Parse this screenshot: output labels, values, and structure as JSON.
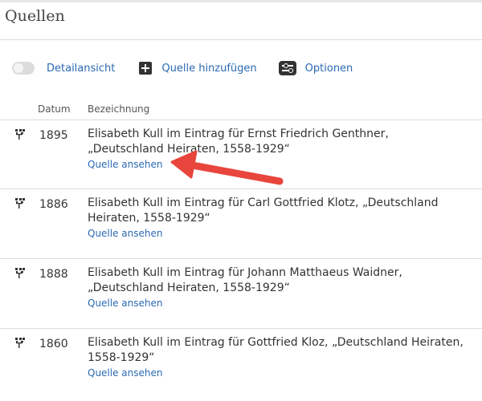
{
  "page": {
    "title": "Quellen"
  },
  "toolbar": {
    "detail_label": "Detailansicht",
    "add_label": "Quelle hinzufügen",
    "options_label": "Optionen"
  },
  "table": {
    "columns": [
      "Datum",
      "Bezeichnung"
    ],
    "rows": [
      {
        "date": "1895",
        "title": "Elisabeth Kull im Eintrag für Ernst Friedrich Genthner, „Deutschland Heiraten, 1558-1929“",
        "link": "Quelle ansehen"
      },
      {
        "date": "1886",
        "title": "Elisabeth Kull im Eintrag für Carl Gottfried Klotz, „Deutschland Heiraten, 1558-1929“",
        "link": "Quelle ansehen"
      },
      {
        "date": "1888",
        "title": "Elisabeth Kull im Eintrag für Johann Matthaeus Waidner, „Deutschland Heiraten, 1558-1929“",
        "link": "Quelle ansehen"
      },
      {
        "date": "1860",
        "title": "Elisabeth Kull im Eintrag für Gottfried Kloz, „Deutschland Heiraten, 1558-1929“",
        "link": "Quelle ansehen"
      }
    ]
  },
  "colors": {
    "link": "#2b6ab3",
    "annotation_arrow": "#e8453c"
  },
  "icons": {
    "row": "family-tree-icon",
    "add": "plus-icon",
    "options": "sliders-icon"
  }
}
